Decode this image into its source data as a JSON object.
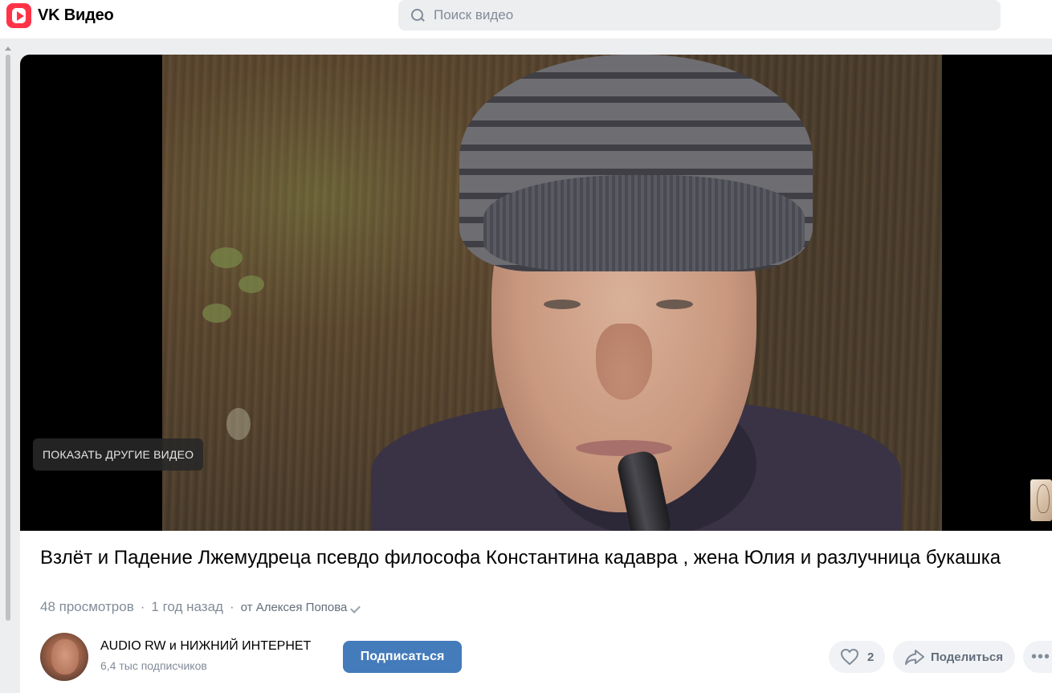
{
  "header": {
    "logo_text": "VK Видео",
    "search_placeholder": "Поиск видео"
  },
  "player": {
    "show_more_label": "ПОКАЗАТЬ ДРУГИЕ ВИДЕО"
  },
  "video": {
    "title": "Взлёт и Падение Лжемудреца псевдо философа Константина кадавра , жена Юлия и разлучница букашка",
    "views": "48 просмотров",
    "uploaded": "1 год назад",
    "author": "от Алексея Попова"
  },
  "channel": {
    "name": "AUDIO RW и НИЖНИЙ ИНТЕРНЕТ",
    "subscribers": "6,4 тыс подписчиков",
    "subscribe_label": "Подписаться"
  },
  "actions": {
    "like_count": "2",
    "share_label": "Поделиться"
  },
  "colors": {
    "brand": "#ff3347",
    "accent": "#447bba",
    "page_bg": "#edeef0"
  }
}
